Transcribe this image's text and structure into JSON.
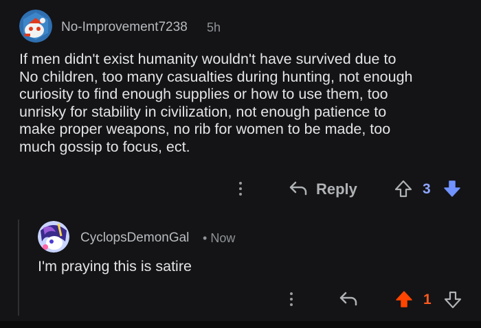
{
  "comment": {
    "username": "No-Improvement7238",
    "age": "5h",
    "body": "If men didn't exist humanity wouldn't have survived due to\nNo children, too many casualties during hunting, not enough\ncuriosity to find enough supplies or how to use them, too\nunrisky for stability in civilization, not enough patience to\nmake proper weapons, no rib for women to be made, too\nmuch gossip to focus, ect.",
    "actions": {
      "reply_label": "Reply",
      "vote_count": "3"
    }
  },
  "reply": {
    "username": "CyclopsDemonGal",
    "separator": "•",
    "age": "Now",
    "body": "I'm praying this is satire",
    "actions": {
      "vote_count": "1"
    }
  },
  "colors": {
    "upvote_active": "#ff4500",
    "downvote_active": "#7193ff",
    "count_blue": "#8ea6ff",
    "count_orange": "#ff5a1f"
  },
  "icons": {
    "top_avatar": "snoo-avatar-icon",
    "reply_avatar": "pony-avatar-icon",
    "more": "kebab-icon",
    "reply": "reply-arrow-icon",
    "upvote": "upvote-arrow-icon",
    "downvote": "downvote-arrow-icon"
  }
}
